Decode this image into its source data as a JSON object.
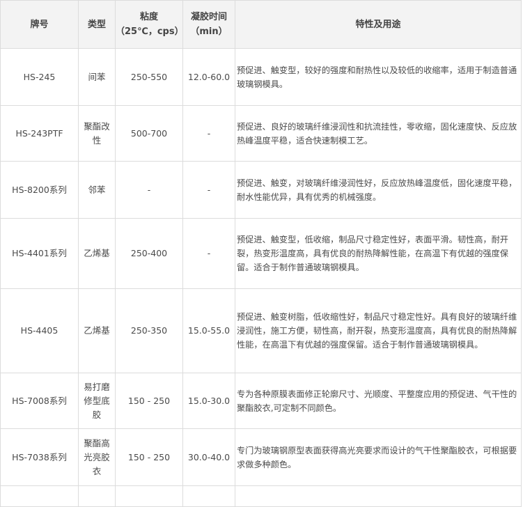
{
  "table": {
    "headers": {
      "brand": "牌号",
      "type": "类型",
      "viscosity_line1": "粘度",
      "viscosity_line2": "（25℃，cps）",
      "gel_line1": "凝胶时间",
      "gel_line2": "（min）",
      "description": "特性及用途"
    },
    "rows": [
      {
        "brand": "HS-245",
        "type": "间苯",
        "viscosity": "250-550",
        "gel_time": "12.0-60.0",
        "description": "预促进、触变型，较好的强度和耐热性以及较低的收缩率，适用于制造普通玻璃钢模具。"
      },
      {
        "brand": "HS-243PTF",
        "type": "聚酯改性",
        "viscosity": "500-700",
        "gel_time": "-",
        "description": "预促进、良好的玻璃纤维浸润性和抗流挂性，零收缩，固化速度快、反应放热峰温度平稳，适合快速制模工艺。"
      },
      {
        "brand": "HS-8200系列",
        "type": "邻苯",
        "viscosity": "-",
        "gel_time": "-",
        "description": "预促进、触变，对玻璃纤维浸润性好，反应放热峰温度低，固化速度平稳，耐水性能优异，具有优秀的机械强度。"
      },
      {
        "brand": "HS-4401系列",
        "type": "乙烯基",
        "viscosity": "250-400",
        "gel_time": "-",
        "description": "预促进、触变型，低收缩，制品尺寸稳定性好，表面平滑。韧性高，耐开裂，热变形温度高，具有优良的耐热降解性能，在高温下有优越的强度保留。适合于制作普通玻璃钢模具。"
      },
      {
        "brand": "HS-4405",
        "type": "乙烯基",
        "viscosity": "250-350",
        "gel_time": "15.0-55.0",
        "description": "预促进、触变树脂，低收缩性好，制品尺寸稳定性好。具有良好的玻璃纤维浸润性，施工方便，韧性高，耐开裂，热变形温度高，具有优良的耐热降解性能，在高温下有优越的强度保留。适合于制作普通玻璃钢模具。"
      },
      {
        "brand": "HS-7008系列",
        "type": "易打磨修型底胶",
        "viscosity": "150 - 250",
        "gel_time": "15.0-30.0",
        "description": "专为各种原膜表面修正轮廓尺寸、光顺度、平整度应用的预促进、气干性的聚酯胶衣,可定制不同颜色。"
      },
      {
        "brand": "HS-7038系列",
        "type": "聚酯高光亮胶衣",
        "viscosity": "150 - 250",
        "gel_time": "30.0-40.0",
        "description": "专门为玻璃钢原型表面获得高光亮要求而设计的气干性聚酯胶衣，可根据要求做多种颜色。"
      }
    ]
  }
}
